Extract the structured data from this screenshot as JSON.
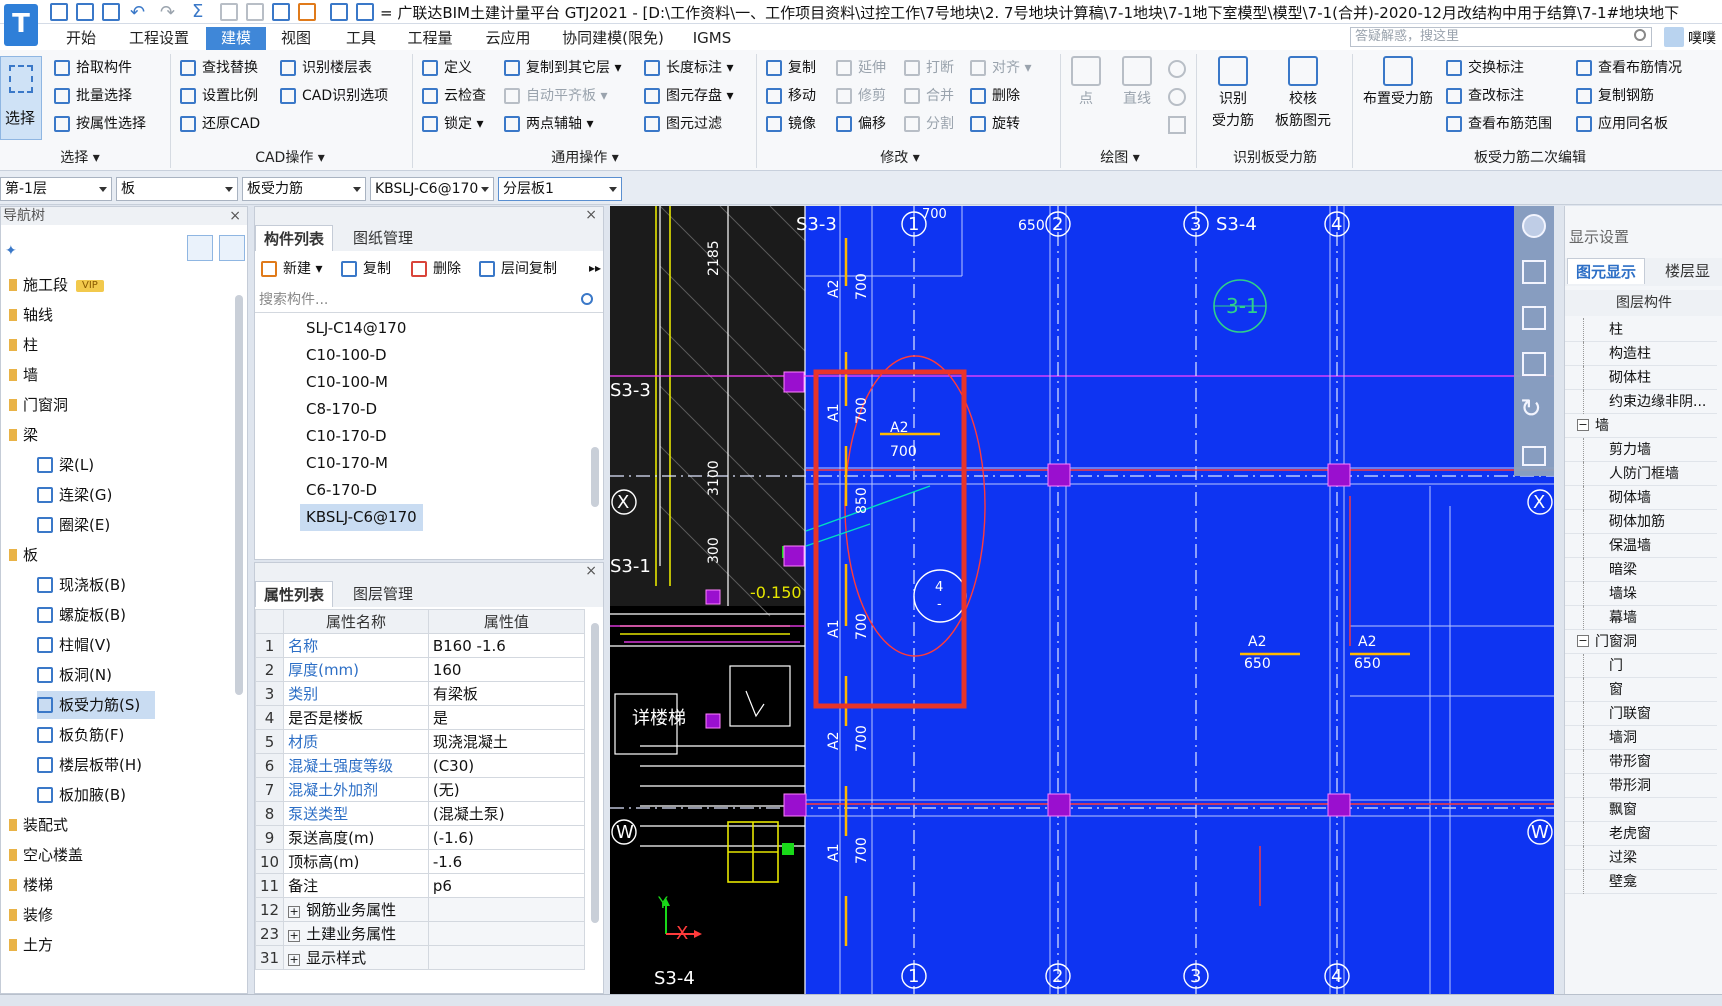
{
  "titlebar": {
    "title": "= 广联达BIM土建计量平台 GTJ2021 - [D:\\工作资料\\一、工作项目资料\\过控工作\\7号地块\\2. 7号地块计算稿\\7-1地块\\7-1地下室模型\\模型\\7-1(合并)-2020-12月改结构中用于结算\\7-1#地块地下"
  },
  "menubar": {
    "tabs": [
      "开始",
      "工程设置",
      "建模",
      "视图",
      "工具",
      "工程量",
      "云应用",
      "协同建模(限免)",
      "IGMS"
    ],
    "active_tab": "建模",
    "search_placeholder": "答疑解惑，搜这里",
    "user_label": "噗噗"
  },
  "ribbon": {
    "select_group": {
      "big_label": "选择",
      "items": [
        "拾取构件",
        "批量选择",
        "按属性选择"
      ],
      "group_label": "选择"
    },
    "cad_group": {
      "col1": [
        "查找替换",
        "设置比例",
        "还原CAD"
      ],
      "col2": [
        "识别楼层表",
        "CAD识别选项"
      ],
      "group_label": "CAD操作"
    },
    "common_group": {
      "col1": [
        "定义",
        "云检查",
        "锁定"
      ],
      "col2": [
        "复制到其它层",
        "自动平齐板",
        "两点辅轴"
      ],
      "col3": [
        "长度标注",
        "图元存盘",
        "图元过滤"
      ],
      "group_label": "通用操作"
    },
    "modify_group": {
      "col1": [
        "复制",
        "移动",
        "镜像"
      ],
      "col2": [
        "延伸",
        "修剪",
        "偏移"
      ],
      "col3": [
        "打断",
        "合并",
        "分割"
      ],
      "col4": [
        "对齐",
        "删除",
        "旋转"
      ],
      "group_label": "修改"
    },
    "draw_group": {
      "items": [
        "点",
        "直线"
      ],
      "group_label": "绘图"
    },
    "identify_group": {
      "items": [
        "识别\n受力筋",
        "校核\n板筋图元"
      ],
      "group_label": "识别板受力筋"
    },
    "edit_group": {
      "big_label": "布置受力筋",
      "col1": [
        "交换标注",
        "查改标注",
        "查看布筋范围"
      ],
      "col2": [
        "查看布筋情况",
        "复制钢筋",
        "应用同名板"
      ],
      "group_label": "板受力筋二次编辑"
    }
  },
  "combobar": {
    "floor": "第-1层",
    "type": "板",
    "subtype": "板受力筋",
    "component": "KBSLJ-C6@170",
    "layer": "分层板1"
  },
  "navtree": {
    "header": "导航树",
    "items": [
      {
        "label": "施工段",
        "kind": "folder",
        "vip": "VIP"
      },
      {
        "label": "轴线",
        "kind": "folder"
      },
      {
        "label": "柱",
        "kind": "folder"
      },
      {
        "label": "墙",
        "kind": "folder"
      },
      {
        "label": "门窗洞",
        "kind": "folder"
      },
      {
        "label": "梁",
        "kind": "folder"
      },
      {
        "label": "梁(L)",
        "kind": "sub"
      },
      {
        "label": "连梁(G)",
        "kind": "sub"
      },
      {
        "label": "圈梁(E)",
        "kind": "sub"
      },
      {
        "label": "板",
        "kind": "folder"
      },
      {
        "label": "现浇板(B)",
        "kind": "sub"
      },
      {
        "label": "螺旋板(B)",
        "kind": "sub"
      },
      {
        "label": "柱帽(V)",
        "kind": "sub"
      },
      {
        "label": "板洞(N)",
        "kind": "sub"
      },
      {
        "label": "板受力筋(S)",
        "kind": "sub",
        "selected": true
      },
      {
        "label": "板负筋(F)",
        "kind": "sub"
      },
      {
        "label": "楼层板带(H)",
        "kind": "sub"
      },
      {
        "label": "板加腋(B)",
        "kind": "sub"
      },
      {
        "label": "装配式",
        "kind": "folder"
      },
      {
        "label": "空心楼盖",
        "kind": "folder"
      },
      {
        "label": "楼梯",
        "kind": "folder"
      },
      {
        "label": "装修",
        "kind": "folder"
      },
      {
        "label": "土方",
        "kind": "folder"
      }
    ]
  },
  "component_panel": {
    "tabs": [
      "构件列表",
      "图纸管理"
    ],
    "toolbar": [
      "新建",
      "复制",
      "删除",
      "层间复制"
    ],
    "search_placeholder": "搜索构件...",
    "items": [
      "SLJ-C14@170",
      "C10-100-D",
      "C10-100-M",
      "C8-170-D",
      "C10-170-D",
      "C10-170-M",
      "C6-170-D",
      "KBSLJ-C6@170"
    ],
    "selected": "KBSLJ-C6@170"
  },
  "property_panel": {
    "tabs": [
      "属性列表",
      "图层管理"
    ],
    "col_name": "属性名称",
    "col_value": "属性值",
    "rows": [
      {
        "n": "1",
        "k": "名称",
        "v": "B160  -1.6",
        "link": true
      },
      {
        "n": "2",
        "k": "厚度(mm)",
        "v": "160",
        "link": true
      },
      {
        "n": "3",
        "k": "类别",
        "v": "有梁板",
        "link": true
      },
      {
        "n": "4",
        "k": "是否是楼板",
        "v": "是",
        "link": false
      },
      {
        "n": "5",
        "k": "材质",
        "v": "现浇混凝土",
        "link": true
      },
      {
        "n": "6",
        "k": "混凝土强度等级",
        "v": "(C30)",
        "link": true
      },
      {
        "n": "7",
        "k": "混凝土外加剂",
        "v": "(无)",
        "link": true
      },
      {
        "n": "8",
        "k": "泵送类型",
        "v": "(混凝土泵)",
        "link": true
      },
      {
        "n": "9",
        "k": "泵送高度(m)",
        "v": "(-1.6)",
        "link": false
      },
      {
        "n": "10",
        "k": "顶标高(m)",
        "v": "-1.6",
        "link": false
      },
      {
        "n": "11",
        "k": "备注",
        "v": "p6",
        "link": false
      },
      {
        "n": "12",
        "k": "钢筋业务属性",
        "v": "",
        "link": false,
        "group": true
      },
      {
        "n": "23",
        "k": "土建业务属性",
        "v": "",
        "link": false,
        "group": true
      },
      {
        "n": "31",
        "k": "显示样式",
        "v": "",
        "link": false,
        "group": true
      }
    ]
  },
  "display_panel": {
    "header": "显示设置",
    "tabs": [
      "图元显示",
      "楼层显示"
    ],
    "col_header": "图层构件",
    "items": [
      {
        "label": "柱",
        "level": 2
      },
      {
        "label": "构造柱",
        "level": 2
      },
      {
        "label": "砌体柱",
        "level": 2
      },
      {
        "label": "约束边缘非阴...",
        "level": 2
      },
      {
        "label": "墙",
        "level": 1
      },
      {
        "label": "剪力墙",
        "level": 2
      },
      {
        "label": "人防门框墙",
        "level": 2
      },
      {
        "label": "砌体墙",
        "level": 2
      },
      {
        "label": "砌体加筋",
        "level": 2
      },
      {
        "label": "保温墙",
        "level": 2
      },
      {
        "label": "暗梁",
        "level": 2
      },
      {
        "label": "墙垛",
        "level": 2
      },
      {
        "label": "幕墙",
        "level": 2
      },
      {
        "label": "门窗洞",
        "level": 1
      },
      {
        "label": "门",
        "level": 2
      },
      {
        "label": "窗",
        "level": 2
      },
      {
        "label": "门联窗",
        "level": 2
      },
      {
        "label": "墙洞",
        "level": 2
      },
      {
        "label": "带形窗",
        "level": 2
      },
      {
        "label": "带形洞",
        "level": 2
      },
      {
        "label": "飘窗",
        "level": 2
      },
      {
        "label": "老虎窗",
        "level": 2
      },
      {
        "label": "过梁",
        "level": 2
      },
      {
        "label": "壁龛",
        "level": 2
      }
    ]
  },
  "canvas": {
    "axis_labels_top": [
      "S3-3",
      "1",
      "650",
      "2",
      "3",
      "S3-4",
      "4"
    ],
    "axis_labels_bottom": [
      "S3-4",
      "1",
      "2",
      "3",
      "4"
    ],
    "row_labels": [
      "S3-3",
      "X",
      "S3-1",
      "W",
      "X",
      "W"
    ],
    "callout": "3-1",
    "detail_marker_top": "4",
    "detail_marker_bottom": "-",
    "rebar_tags": [
      "A2",
      "700",
      "A1",
      "700",
      "A2",
      "700",
      "850",
      "A1",
      "700",
      "A2",
      "650",
      "A2",
      "650",
      "A2",
      "700",
      "A1",
      "700"
    ],
    "dims": [
      "2185",
      "3100",
      "300",
      "-0.150"
    ],
    "dim_top": "700",
    "stair_text": "详楼梯",
    "axis_x": "X",
    "axis_y": "Y"
  },
  "colors": {
    "canvas_bg": "#0e34f2",
    "accent": "#3f87d8",
    "highlight_box": "#e8342a",
    "column": "#9a0fcf"
  }
}
